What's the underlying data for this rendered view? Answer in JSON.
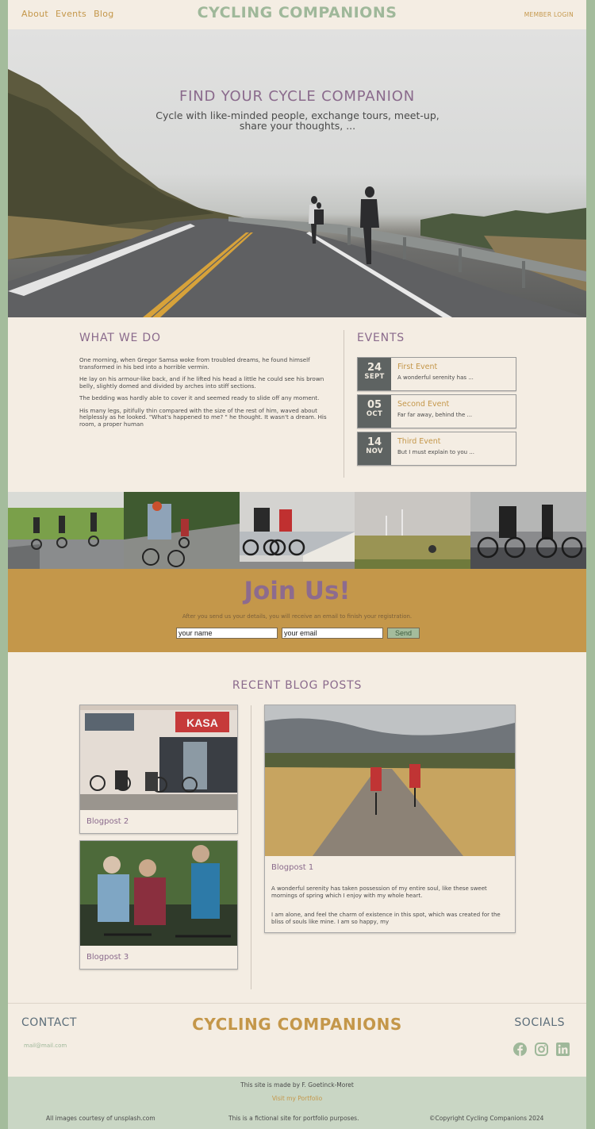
{
  "header": {
    "nav": [
      "About",
      "Events",
      "Blog"
    ],
    "logo": "CYCLING COMPANIONS",
    "member_login": "MEMBER LOGIN"
  },
  "hero": {
    "title": "FIND YOUR CYCLE COMPANION",
    "subtitle": "Cycle with like-minded people, exchange tours, meet-up, share your thoughts, ..."
  },
  "what_we_do": {
    "heading": "WHAT WE DO",
    "paragraphs": [
      "One morning, when Gregor Samsa woke from troubled dreams, he found himself transformed in his bed into a horrible vermin.",
      "He lay on his armour-like back, and if he lifted his head a little he could see his brown belly, slightly domed and divided by arches into stiff sections.",
      "The bedding was hardly able to cover it and seemed ready to slide off any moment.",
      "His many legs, pitifully thin compared with the size of the rest of him, waved about helplessly as he looked. \"What's happened to me? \" he thought. It wasn't a dream. His room, a proper human"
    ]
  },
  "events": {
    "heading": "EVENTS",
    "items": [
      {
        "day": "24",
        "month": "SEPT",
        "title": "First Event",
        "desc": "A wonderful serenity has ..."
      },
      {
        "day": "05",
        "month": "OCT",
        "title": "Second Event",
        "desc": "Far far away, behind the ..."
      },
      {
        "day": "14",
        "month": "NOV",
        "title": "Third Event",
        "desc": "But I must explain to you ..."
      }
    ]
  },
  "join": {
    "heading": "Join Us!",
    "subtitle": "After you send us your details, you will receive an email to finish your registration.",
    "name_value": "your name",
    "email_value": "your email",
    "send_label": "Send"
  },
  "blog": {
    "heading": "RECENT BLOG POSTS",
    "post1": {
      "title": "Blogpost 1",
      "p1": "A wonderful serenity has taken possession of my entire soul, like these sweet mornings of spring which I enjoy with my whole heart.",
      "p2": "I am alone, and feel the charm of existence in this spot, which was created for the bliss of souls like mine. I am so happy, my"
    },
    "post2": {
      "title": "Blogpost 2",
      "shop_sign": "KASA"
    },
    "post3": {
      "title": "Blogpost 3"
    }
  },
  "footer": {
    "contact_heading": "CONTACT",
    "email": "mail@mail.com",
    "logo": "CYCLING COMPANIONS",
    "socials_heading": "SOCIALS",
    "social_icons": [
      "facebook-icon",
      "instagram-icon",
      "linkedin-icon"
    ],
    "made_by": "This site is made by F. Goetinck-Moret",
    "portfolio": "Visit my Portfolio",
    "images_credit": "All images courtesy of unsplash.com",
    "fictional": "This is a fictional site for portfolio purposes.",
    "copyright": "©Copyright Cycling Companions 2024"
  },
  "colors": {
    "accent_gold": "#c4974a",
    "accent_purple": "#8a6a8c",
    "sage": "#a4bc9c",
    "cream": "#f4ede3",
    "event_date_bg": "#5e6362"
  }
}
